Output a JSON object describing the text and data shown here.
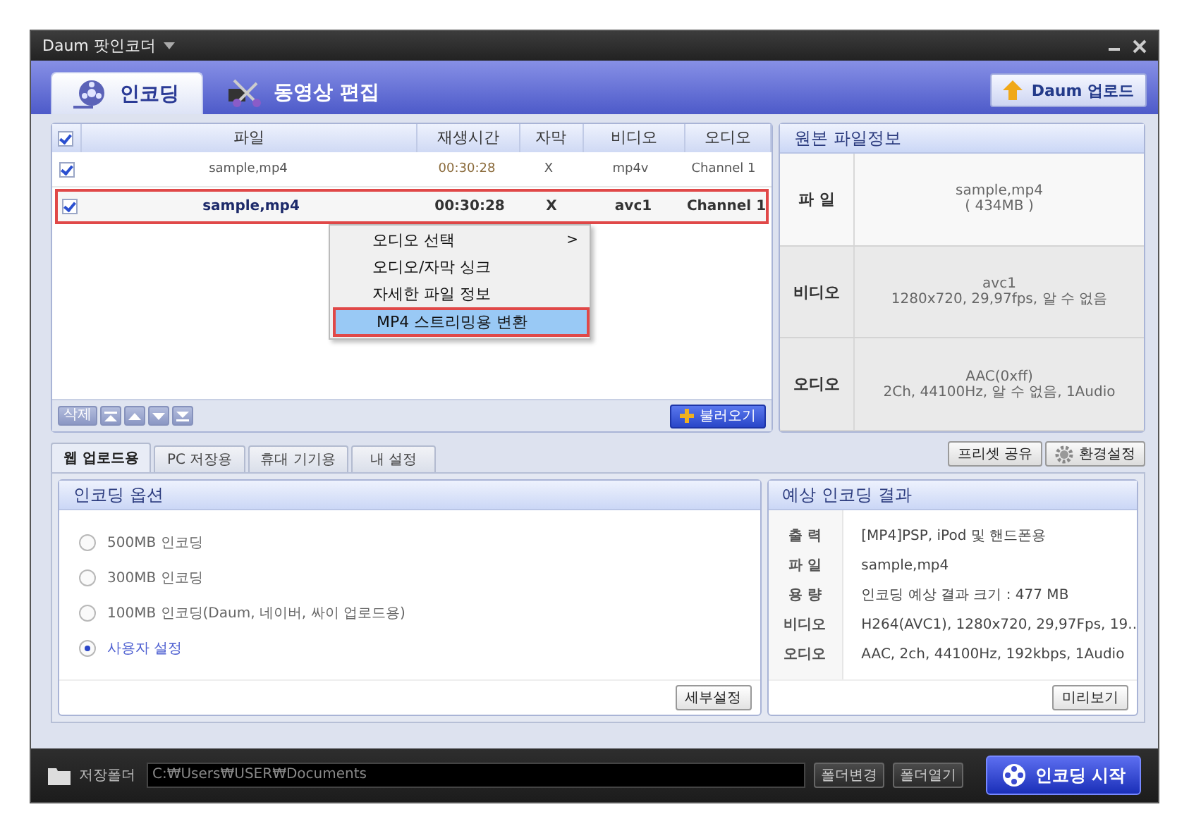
{
  "window": {
    "title": "Daum 팟인코더"
  },
  "main_tabs": [
    {
      "label": "인코딩",
      "selected": true
    },
    {
      "label": "동영상 편집",
      "selected": false
    }
  ],
  "upload_button": "Daum 업로드",
  "file_table": {
    "all_checked": true,
    "columns": [
      "파일",
      "재생시간",
      "자막",
      "비디오",
      "오디오"
    ],
    "rows": [
      {
        "file": "sample,mp4",
        "duration": "00:30:28",
        "subtitle": "X",
        "video": "mp4v",
        "audio": "Channel 1",
        "checked": true,
        "selected": false
      },
      {
        "file": "sample,mp4",
        "duration": "00:30:28",
        "subtitle": "X",
        "video": "avc1",
        "audio": "Channel 1",
        "checked": true,
        "selected": true
      }
    ]
  },
  "context_menu": {
    "items": [
      {
        "label": "오디오 선택",
        "arrow": ">",
        "selected": false
      },
      {
        "label": "오디오/자막 싱크",
        "selected": false
      },
      {
        "label": "자세한 파일 정보",
        "selected": false
      },
      {
        "label": "MP4 스트리밍용 변환",
        "selected": true
      }
    ]
  },
  "list_toolbar": {
    "delete": "삭제",
    "load": "불러오기"
  },
  "source_info": {
    "title": "원본 파일정보",
    "rows": [
      {
        "label": "파 일",
        "lines": [
          "sample,mp4",
          "( 434MB )"
        ]
      },
      {
        "label": "비디오",
        "lines": [
          "avc1",
          "1280x720, 29,97fps, 알 수 없음"
        ]
      },
      {
        "label": "오디오",
        "lines": [
          "AAC(0xff)",
          "2Ch, 44100Hz, 알 수 없음, 1Audio"
        ]
      }
    ]
  },
  "preset_tabs": [
    {
      "label": "웹 업로드용",
      "selected": true
    },
    {
      "label": "PC 저장용",
      "selected": false
    },
    {
      "label": "휴대 기기용",
      "selected": false
    },
    {
      "label": "내 설정",
      "selected": false
    }
  ],
  "preset_share": "프리셋 공유",
  "settings": "환경설정",
  "encoding_options": {
    "title": "인코딩 옵션",
    "options": [
      {
        "label": "500MB 인코딩",
        "selected": false
      },
      {
        "label": "300MB 인코딩",
        "selected": false
      },
      {
        "label": "100MB 인코딩(Daum, 네이버, 싸이 업로드용)",
        "selected": false
      },
      {
        "label": "사용자 설정",
        "selected": true
      }
    ],
    "detail_button": "세부설정"
  },
  "result": {
    "title": "예상 인코딩 결과",
    "rows": [
      {
        "label": "출 력",
        "value": "[MP4]PSP, iPod 및 핸드폰용"
      },
      {
        "label": "파 일",
        "value": "sample,mp4"
      },
      {
        "label": "용 량",
        "value": "인코딩 예상 결과 크기 : 477 MB"
      },
      {
        "label": "비디오",
        "value": "H264(AVC1), 1280x720, 29,97Fps, 19.."
      },
      {
        "label": "오디오",
        "value": "AAC, 2ch, 44100Hz, 192kbps, 1Audio"
      }
    ],
    "preview_button": "미리보기"
  },
  "footer": {
    "folder_label": "저장폴더",
    "path": "C:₩Users₩USER₩Documents",
    "change_button": "폴더변경",
    "open_button": "폴더열기",
    "start_button": "인코딩 시작"
  }
}
